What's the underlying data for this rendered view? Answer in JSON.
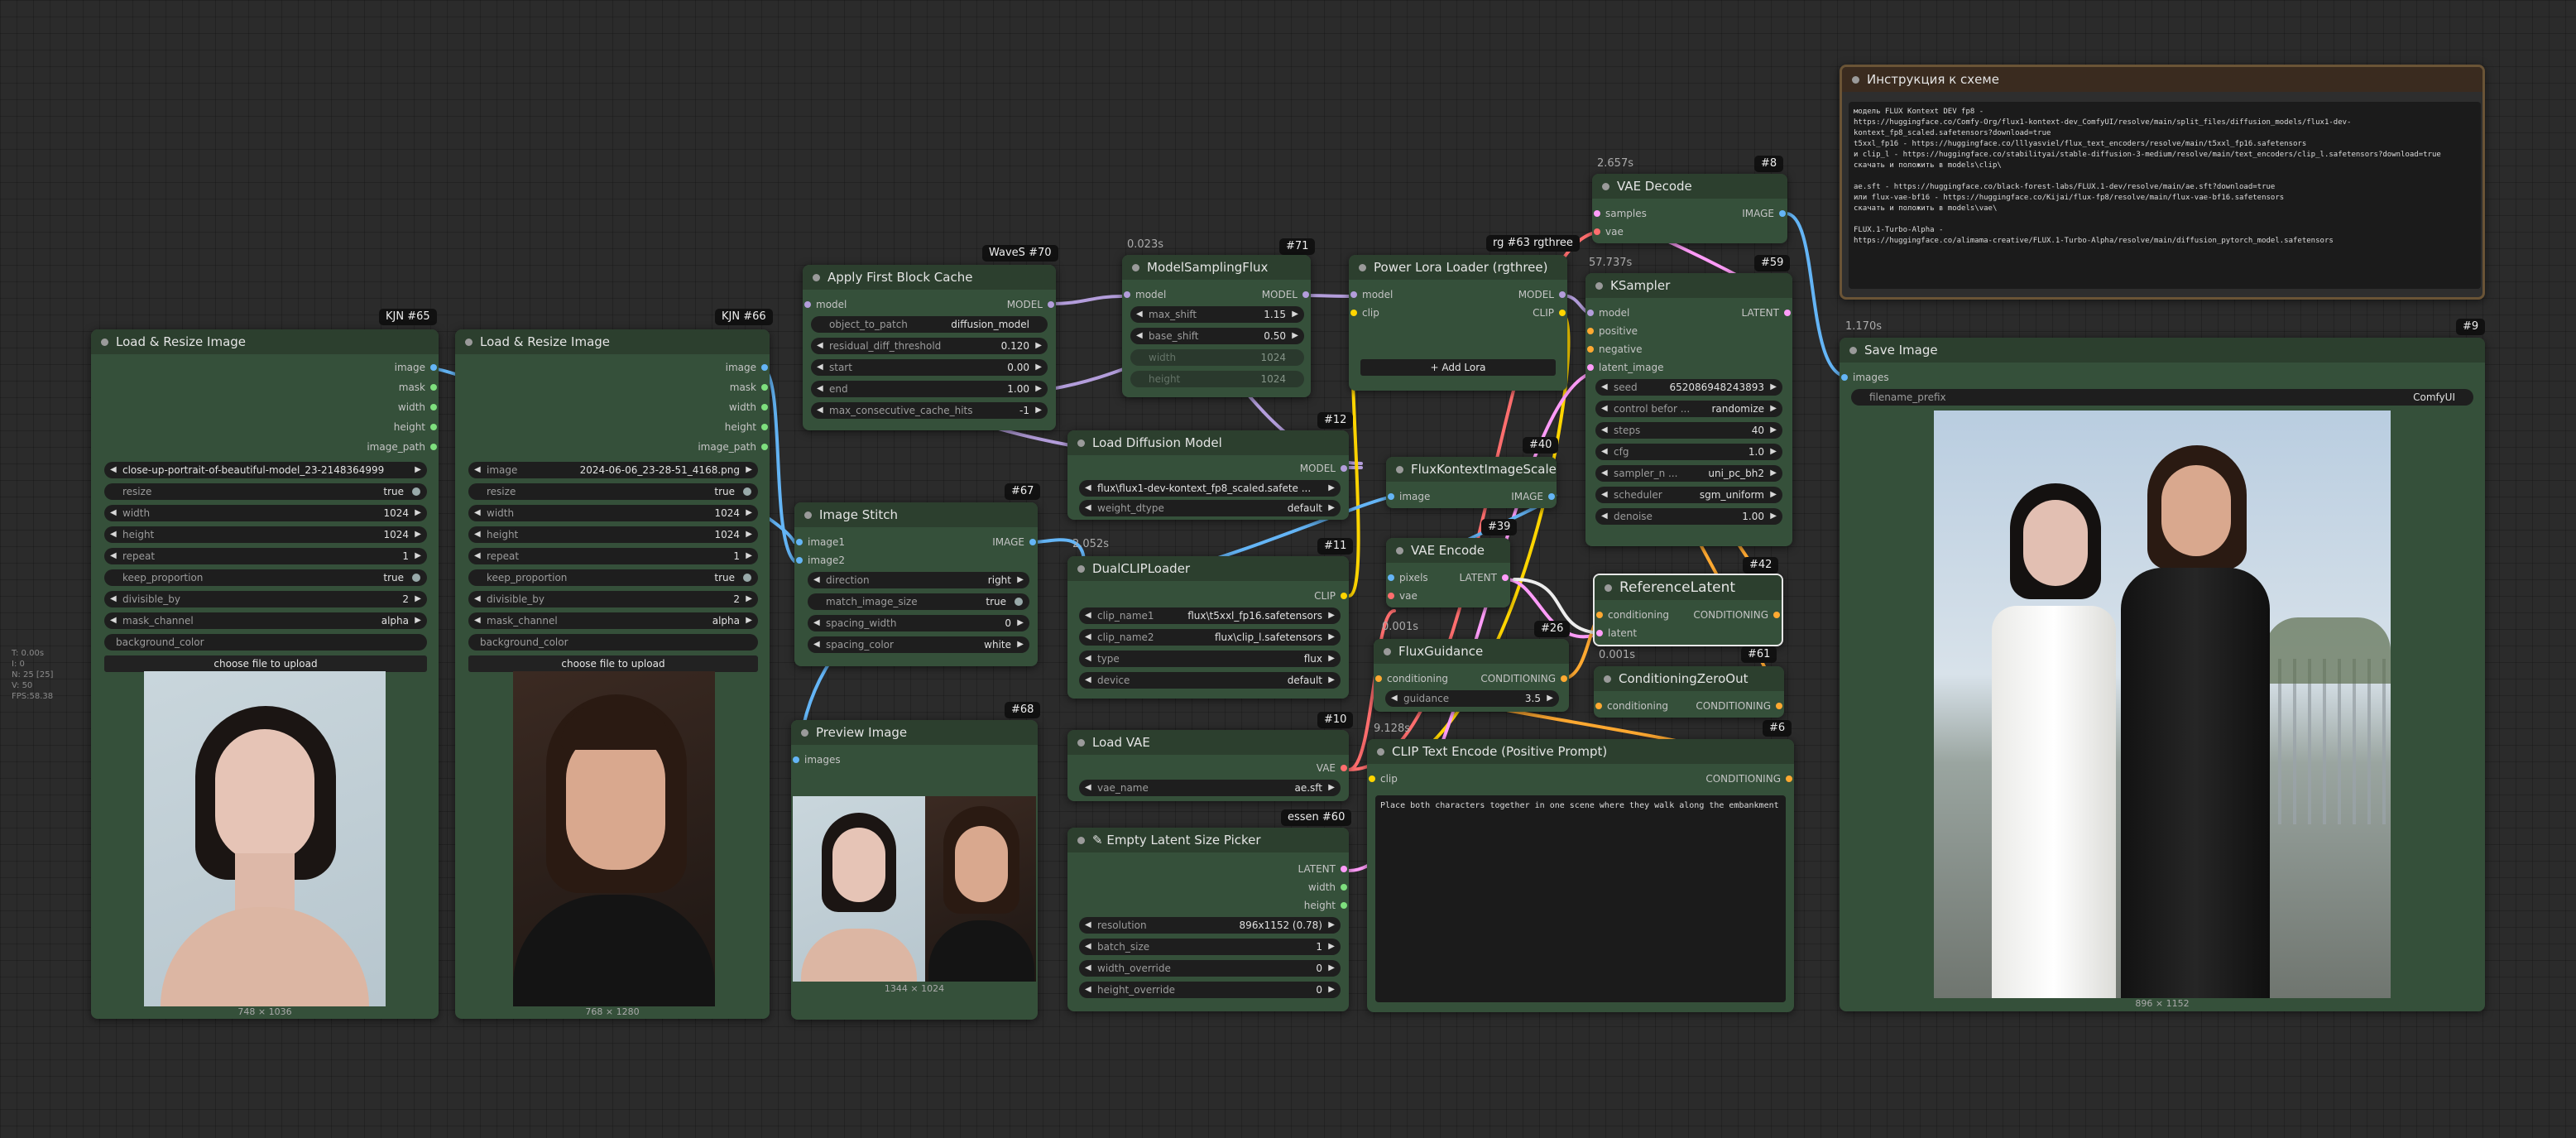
{
  "canvas_stats": {
    "line1": "T: 0.00s",
    "line2": "I: 0",
    "line3": "N: 25 [25]",
    "line4": "V: 50",
    "line5": "FPS:58.38"
  },
  "n65": {
    "badge": "KJN #65",
    "title": "Load & Resize Image",
    "outs": [
      "image",
      "mask",
      "width",
      "height",
      "image_path"
    ],
    "image": "close-up-portrait-of-beautiful-model_23-2148364999",
    "resize": "true",
    "width": "1024",
    "height": "1024",
    "repeat": "1",
    "keep_proportion": "true",
    "divisible_by": "2",
    "mask_channel": "alpha",
    "background_color": "background_color",
    "upload": "choose file to upload",
    "size": "748 × 1036"
  },
  "n66": {
    "badge": "KJN #66",
    "title": "Load & Resize Image",
    "outs": [
      "image",
      "mask",
      "width",
      "height",
      "image_path"
    ],
    "image": "2024-06-06_23-28-51_4168.png",
    "resize": "true",
    "width": "1024",
    "height": "1024",
    "repeat": "1",
    "keep_proportion": "true",
    "divisible_by": "2",
    "mask_channel": "alpha",
    "background_color": "background_color",
    "upload": "choose file to upload",
    "size": "768 × 1280"
  },
  "labels": {
    "image": "image",
    "resize": "resize",
    "width": "width",
    "height": "height",
    "repeat": "repeat",
    "keep_proportion": "keep_proportion",
    "divisible_by": "divisible_by",
    "mask_channel": "mask_channel"
  },
  "n70": {
    "badge": "WaveS #70",
    "title": "Apply First Block Cache",
    "in_model": "model",
    "out_model": "MODEL",
    "w": [
      {
        "l": "object_to_patch",
        "v": "diffusion_model"
      },
      {
        "l": "residual_diff_threshold",
        "v": "0.120"
      },
      {
        "l": "start",
        "v": "0.00"
      },
      {
        "l": "end",
        "v": "1.00"
      },
      {
        "l": "max_consecutive_cache_hits",
        "v": "-1"
      }
    ]
  },
  "n67": {
    "badge": "#67",
    "title": "Image Stitch",
    "ins": [
      "image1",
      "image2"
    ],
    "out": "IMAGE",
    "w": [
      {
        "l": "direction",
        "v": "right"
      },
      {
        "l": "match_image_size",
        "v": "true"
      },
      {
        "l": "spacing_width",
        "v": "0"
      },
      {
        "l": "spacing_color",
        "v": "white"
      }
    ]
  },
  "n68": {
    "badge": "#68",
    "title": "Preview Image",
    "in": "images",
    "size": "1344 × 1024"
  },
  "n71": {
    "time": "0.023s",
    "badge": "#71",
    "title": "ModelSamplingFlux",
    "in_model": "model",
    "out_model": "MODEL",
    "w": [
      {
        "l": "max_shift",
        "v": "1.15"
      },
      {
        "l": "base_shift",
        "v": "0.50"
      },
      {
        "l": "width",
        "v": "1024"
      },
      {
        "l": "height",
        "v": "1024"
      }
    ]
  },
  "n12": {
    "badge": "#12",
    "title": "Load Diffusion Model",
    "out": "MODEL",
    "w": [
      {
        "l": "",
        "v": "flux\\flux1-dev-kontext_fp8_scaled.safete ..."
      },
      {
        "l": "weight_dtype",
        "v": "default"
      }
    ]
  },
  "n11": {
    "time": "2.052s",
    "badge": "#11",
    "title": "DualCLIPLoader",
    "out": "CLIP",
    "w": [
      {
        "l": "clip_name1",
        "v": "flux\\t5xxl_fp16.safetensors"
      },
      {
        "l": "clip_name2",
        "v": "flux\\clip_l.safetensors"
      },
      {
        "l": "type",
        "v": "flux"
      },
      {
        "l": "device",
        "v": "default"
      }
    ]
  },
  "n10": {
    "badge": "#10",
    "title": "Load VAE",
    "out": "VAE",
    "w": [
      {
        "l": "vae_name",
        "v": "ae.sft"
      }
    ]
  },
  "n60": {
    "badge": "essen #60",
    "title": "Empty Latent Size Picker",
    "outs": [
      "LATENT",
      "width",
      "height"
    ],
    "w": [
      {
        "l": "resolution",
        "v": "896x1152 (0.78)"
      },
      {
        "l": "batch_size",
        "v": "1"
      },
      {
        "l": "width_override",
        "v": "0"
      },
      {
        "l": "height_override",
        "v": "0"
      }
    ]
  },
  "n63": {
    "badge": "rg #63 rgthree",
    "title": "Power Lora Loader (rgthree)",
    "ins": [
      "model",
      "clip"
    ],
    "outs": [
      "MODEL",
      "CLIP"
    ],
    "add": "+ Add Lora"
  },
  "n40": {
    "badge": "#40",
    "title": "FluxKontextImageScale",
    "in": "image",
    "out": "IMAGE"
  },
  "n39": {
    "badge": "#39",
    "title": "VAE Encode",
    "ins": [
      "pixels",
      "vae"
    ],
    "out": "LATENT"
  },
  "n26": {
    "time": "0.001s",
    "badge": "#26",
    "title": "FluxGuidance",
    "in": "conditioning",
    "out": "CONDITIONING",
    "w": [
      {
        "l": "guidance",
        "v": "3.5"
      }
    ]
  },
  "n6": {
    "time": "9.128s",
    "badge": "#6",
    "title": "CLIP Text Encode (Positive Prompt)",
    "in": "clip",
    "out": "CONDITIONING",
    "text": "Place both characters together in one scene where they walk along the embankment"
  },
  "n8": {
    "time": "2.657s",
    "badge": "#8",
    "title": "VAE Decode",
    "ins": [
      "samples",
      "vae"
    ],
    "out": "IMAGE"
  },
  "n59": {
    "time": "57.737s",
    "badge": "#59",
    "title": "KSampler",
    "ins": [
      "model",
      "positive",
      "negative",
      "latent_image"
    ],
    "out": "LATENT",
    "w": [
      {
        "l": "seed",
        "v": "652086948243893"
      },
      {
        "l": "control befor ...",
        "v": "randomize"
      },
      {
        "l": "steps",
        "v": "40"
      },
      {
        "l": "cfg",
        "v": "1.0"
      },
      {
        "l": "sampler_n ...",
        "v": "uni_pc_bh2"
      },
      {
        "l": "scheduler",
        "v": "sgm_uniform"
      },
      {
        "l": "denoise",
        "v": "1.00"
      }
    ]
  },
  "n42": {
    "badge": "#42",
    "title": "ReferenceLatent",
    "ins": [
      "conditioning",
      "latent"
    ],
    "out": "CONDITIONING"
  },
  "n61": {
    "time": "0.001s",
    "badge": "#61",
    "title": "ConditioningZeroOut",
    "in": "conditioning",
    "out": "CONDITIONING"
  },
  "note": {
    "title": "Инструкция к схеме",
    "text": "модель FLUX Kontext DEV fp8 -\nhttps://huggingface.co/Comfy-Org/flux1-kontext-dev_ComfyUI/resolve/main/split_files/diffusion_models/flux1-dev-kontext_fp8_scaled.safetensors?download=true\nt5xxl_fp16 - https://huggingface.co/lllyasviel/flux_text_encoders/resolve/main/t5xxl_fp16.safetensors\nи clip_l - https://huggingface.co/stabilityai/stable-diffusion-3-medium/resolve/main/text_encoders/clip_l.safetensors?download=true\nскачать и положить в models\\clip\\\n\nae.sft - https://huggingface.co/black-forest-labs/FLUX.1-dev/resolve/main/ae.sft?download=true\nили flux-vae-bf16 - https://huggingface.co/Kijai/flux-fp8/resolve/main/flux-vae-bf16.safetensors\nскачать и положить в models\\vae\\\n\nFLUX.1-Turbo-Alpha -\nhttps://huggingface.co/alimama-creative/FLUX.1-Turbo-Alpha/resolve/main/diffusion_pytorch_model.safetensors"
  },
  "n9": {
    "time": "1.170s",
    "badge": "#9",
    "title": "Save Image",
    "in": "images",
    "w": [
      {
        "l": "filename_prefix",
        "v": "ComfyUI"
      }
    ],
    "size": "896 × 1152"
  },
  "colors": {
    "model": "#b39ddb",
    "clip": "#ffd500",
    "vae": "#ff6e6e",
    "latent": "#ff9cf9",
    "image": "#64b5f6",
    "conditioning": "#ffa931",
    "int": "#7ee07e",
    "node": "#35503a",
    "header": "#2c3f2e"
  }
}
